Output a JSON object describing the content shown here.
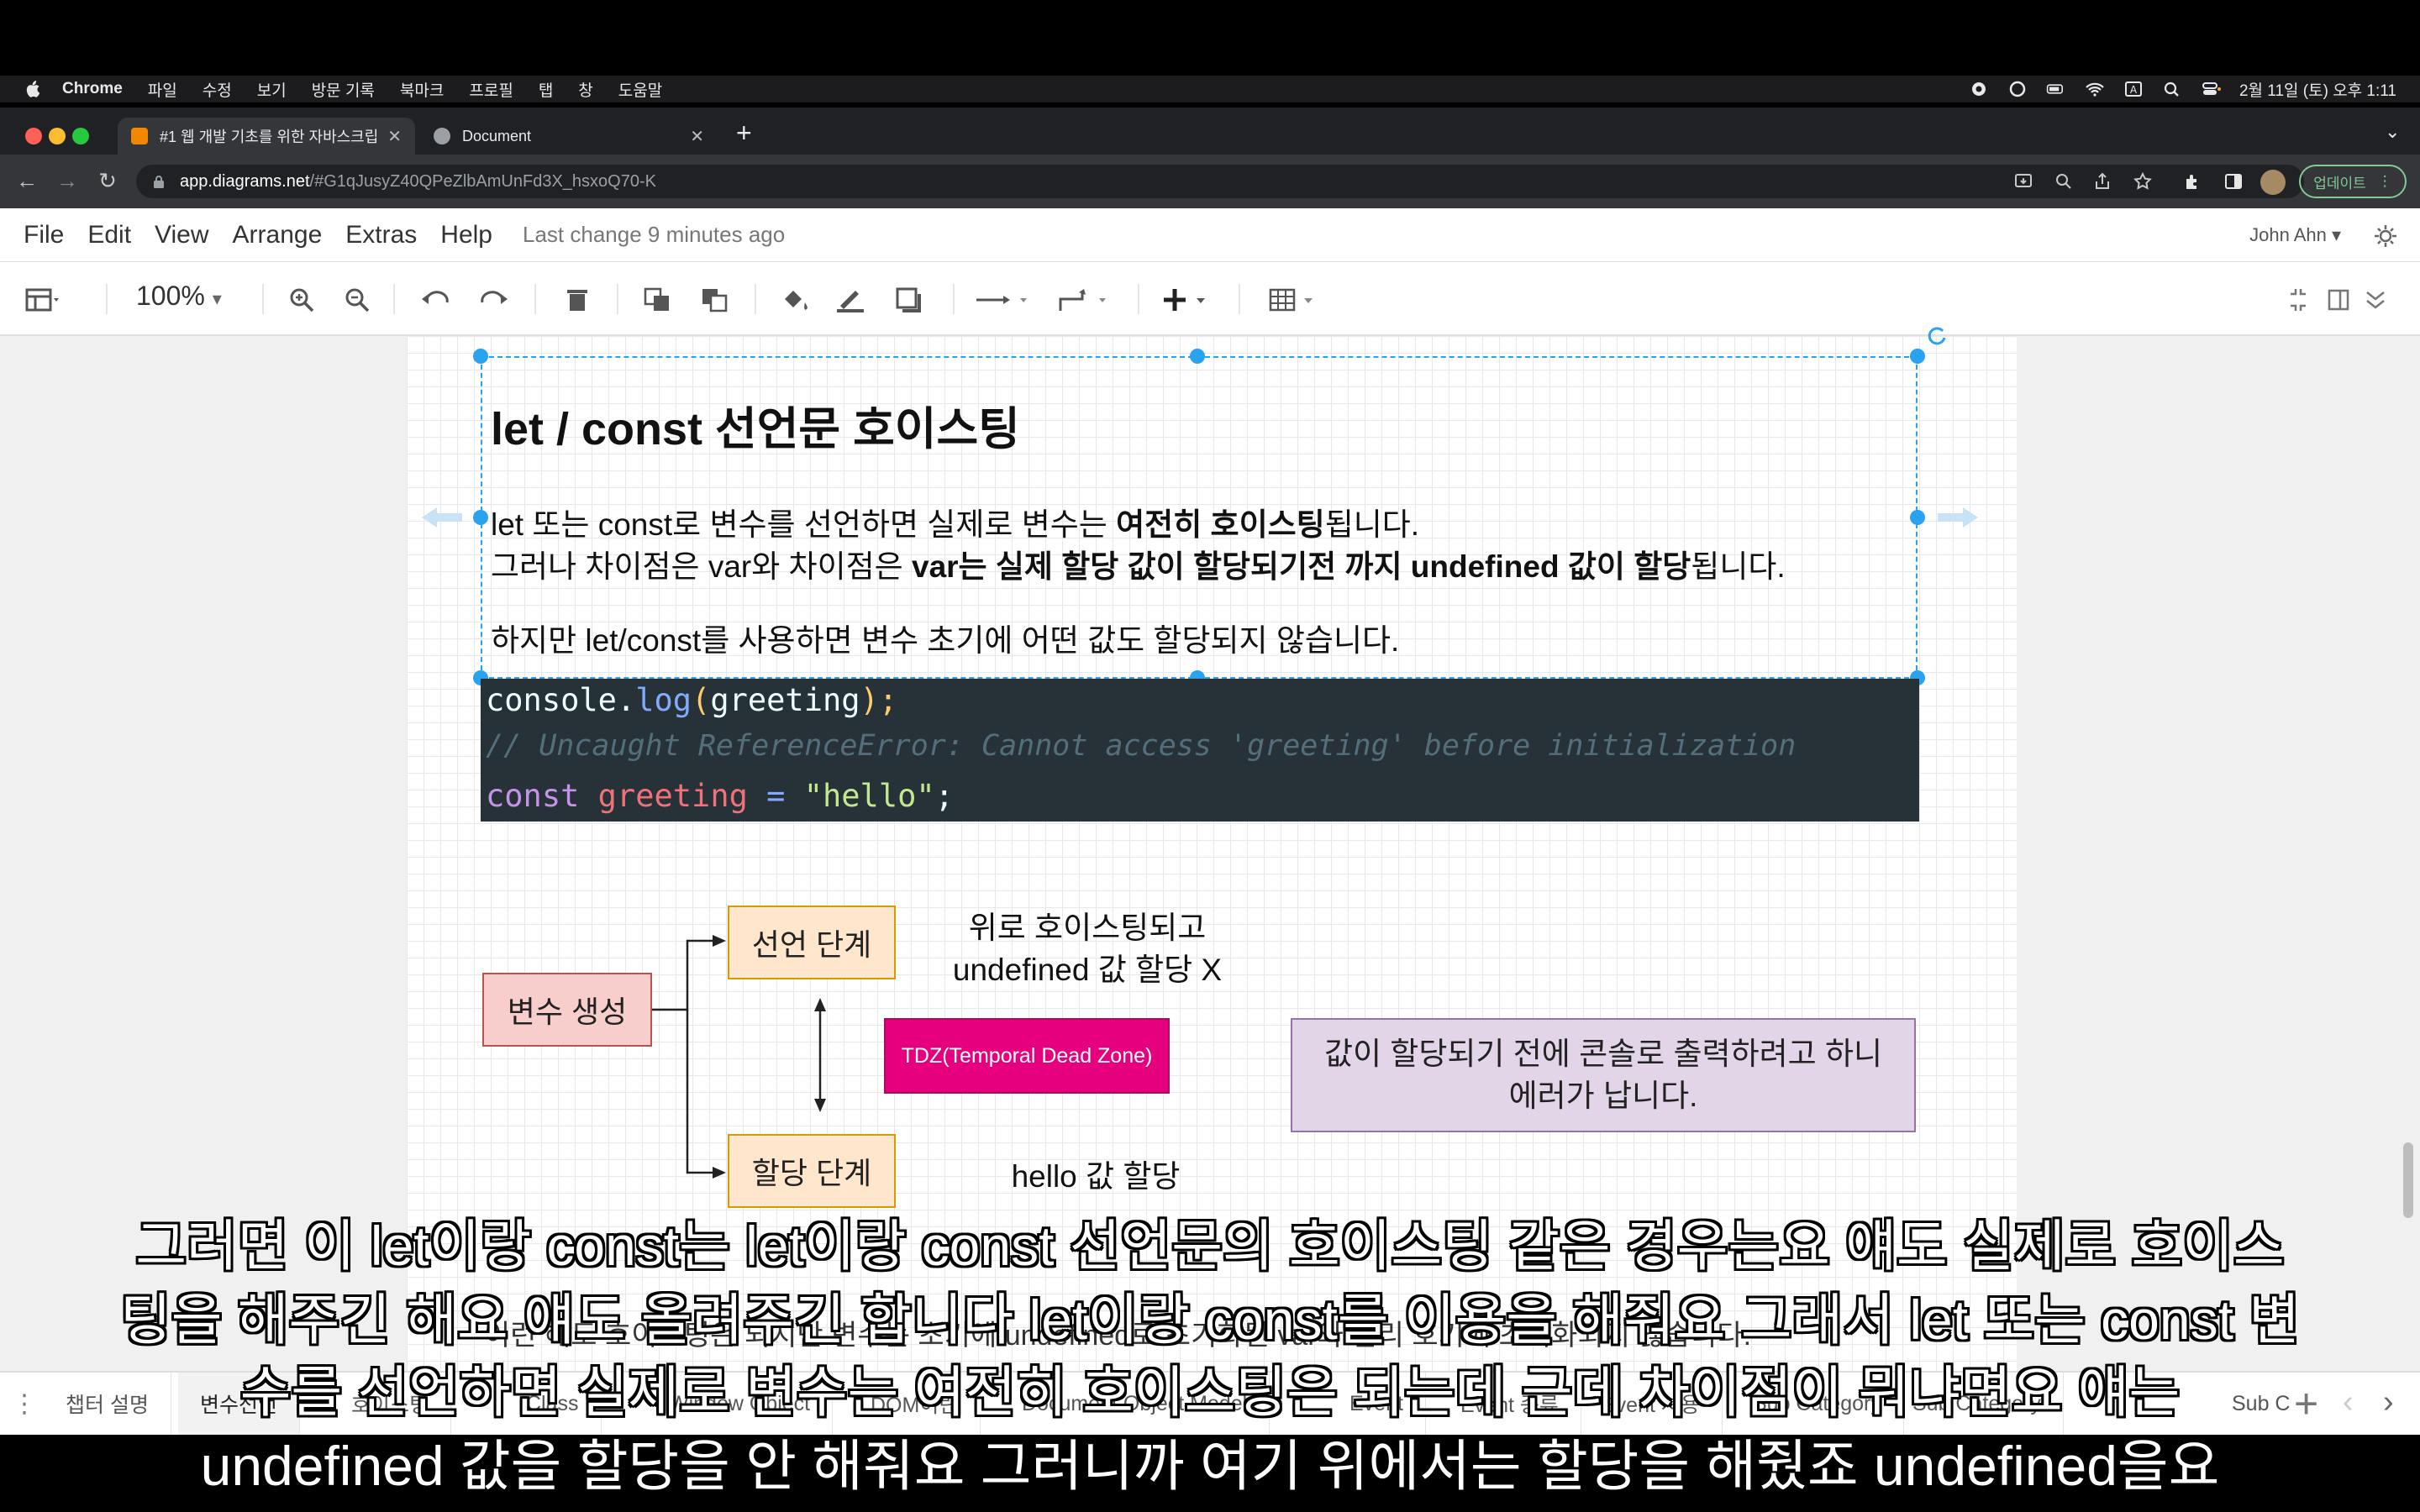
{
  "mac_menu": {
    "app": "Chrome",
    "items": [
      "파일",
      "수정",
      "보기",
      "방문 기록",
      "북마크",
      "프로필",
      "탭",
      "창",
      "도움말"
    ],
    "clock": "2월 11일 (토) 오후 1:11"
  },
  "browser": {
    "tabs": [
      {
        "title": "#1 웹 개발 기초를 위한 자바스크립트",
        "favicon_color": "#f08705"
      },
      {
        "title": "Document",
        "favicon_color": "#9aa0a6"
      }
    ],
    "url_host": "app.diagrams.net",
    "url_path": "/#G1qJusyZ40QPeZlbAmUnFd3X_hsxoQ70-K",
    "update_label": "업데이트"
  },
  "drawio": {
    "menu": [
      "File",
      "Edit",
      "View",
      "Arrange",
      "Extras",
      "Help"
    ],
    "last_change": "Last change 9 minutes ago",
    "user": "John Ahn",
    "zoom": "100%"
  },
  "content": {
    "title": "let / const 선언문 호이스팅",
    "para1_a": "let 또는 const로 변수를 선언하면 실제로 변수는 ",
    "para1_b": "여전히 호이스팅",
    "para1_c": "됩니다.",
    "para2_a": "그러나 차이점은 var와 차이점은 ",
    "para2_b": "var는 실제 할당 값이 할당되기전 까지 undefined 값이 할당",
    "para2_c": "됩니다.",
    "para3": "하지만 let/const를 사용하면 변수 초기에 어떤 값도 할당되지 않습니다.",
    "code": {
      "l1_obj": "console",
      "l1_dot": ".",
      "l1_fn": "log",
      "l1_po": "(",
      "l1_arg": "greeting",
      "l1_pc": ")",
      "l1_semi": ";",
      "l2": "// Uncaught ReferenceError: Cannot access 'greeting' before initialization",
      "l3_kw": "const",
      "l3_var": "greeting",
      "l3_eq": "=",
      "l3_str": "\"hello\"",
      "l3_semi": ";"
    }
  },
  "diagram": {
    "var_create": "변수 생성",
    "decl_phase": "선언 단계",
    "assign_phase": "할당 단계",
    "tdz": "TDZ(Temporal Dead Zone)",
    "decl_note_1": "위로 호이스팅되고",
    "decl_note_2": "undefined 값 할당 X",
    "assign_note": "hello 값 할당",
    "error_note_1": "값이 할당되기 전에 콘솔로 출력하려고 하니",
    "error_note_2": "에러가 납니다.",
    "bottom_note": "이런 해도 호이스팅은 되지만 변수는 초기에 undefined로 초기화된 var와 달리 호기에 초기화되지 않습니다."
  },
  "page_tabs": [
    "챕터 설명",
    "변수선언",
    "호이스팅",
    "Class",
    "Window Object",
    "DOM이란",
    "Document Object Model",
    "Event",
    "Event 종류",
    "Event 사용",
    "Sub Category",
    "Sub Category",
    "Sub C"
  ],
  "subtitles": [
    "그러면 이 let이랑 const는 let이랑 const 선언문의 호이스팅 같은 경우는요 얘도 실제로 호이스",
    "팅을 해주긴 해요 얘도 올려주긴 합니다 let이랑 const를 이용을 해줘요 그래서 let 또는 const 변",
    "수를 선언하면 실제로 변수는 여전히 호이스팅은 되는데 근데 차이점이 뭐냐면요 얘는",
    "undefined 값을 할당을 안 해줘요 그러니까 여기 위에서는 할당을 해줬죠 undefined을요"
  ]
}
